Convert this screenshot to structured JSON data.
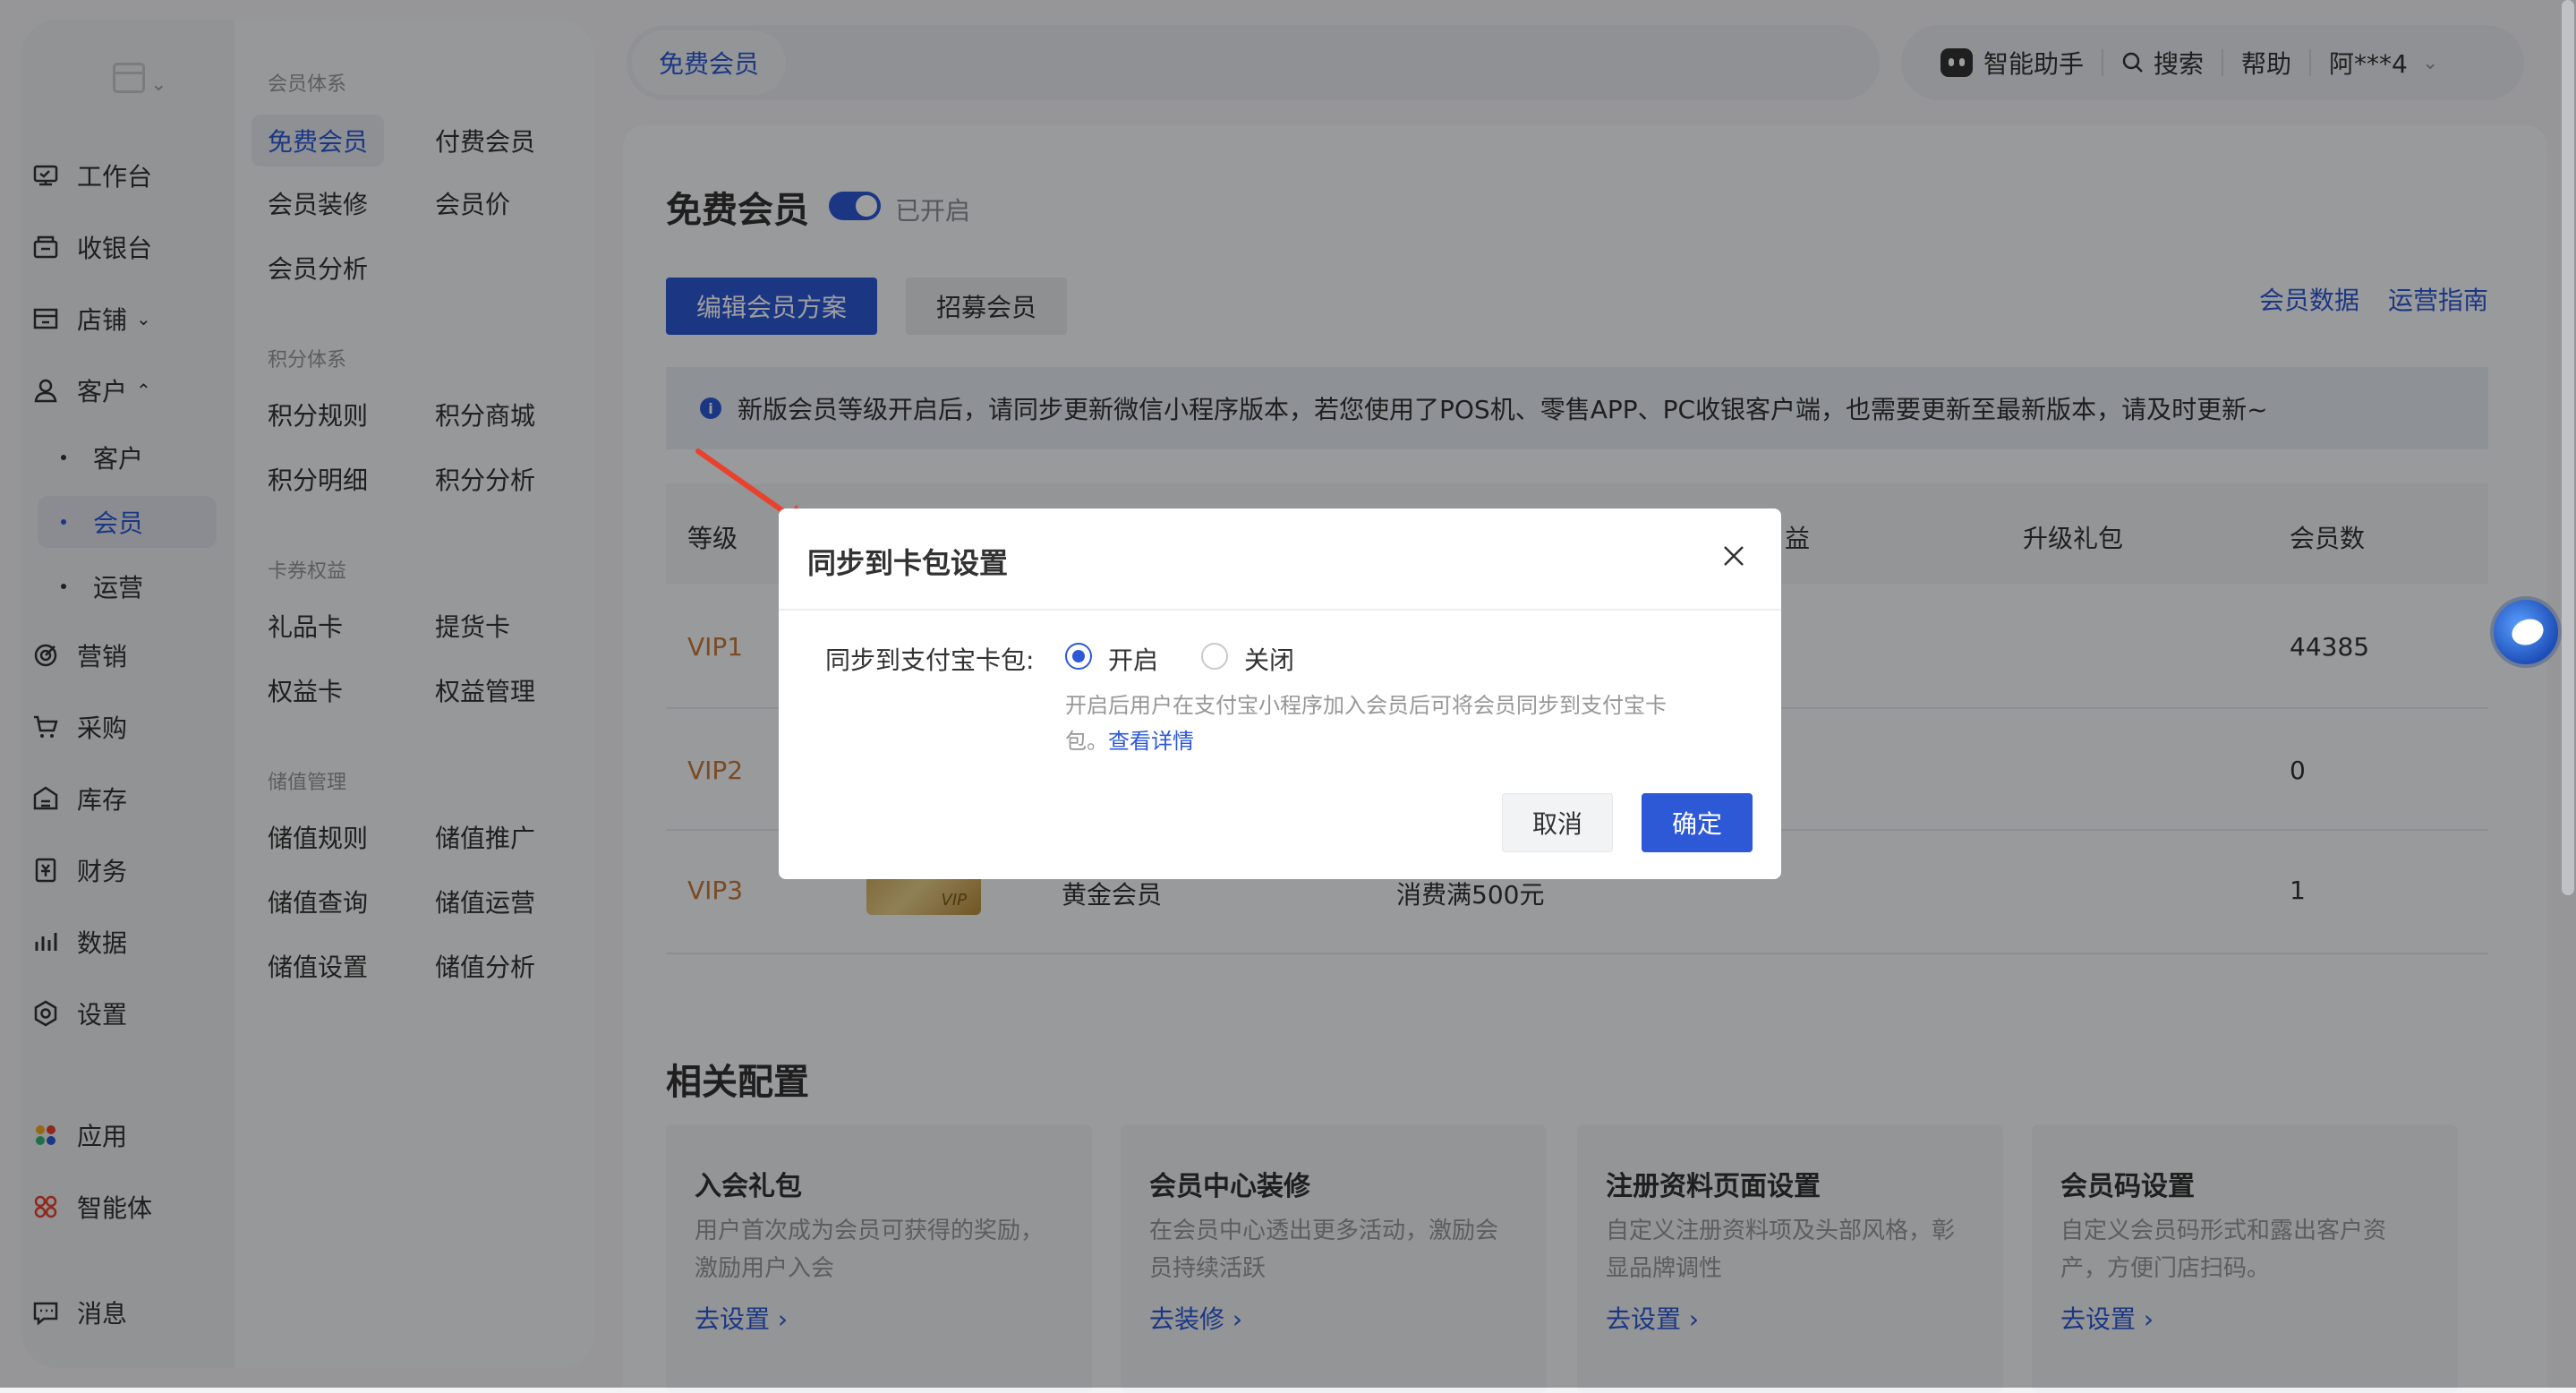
{
  "nav": {
    "items": [
      {
        "label": "工作台",
        "icon": "workbench-icon"
      },
      {
        "label": "收银台",
        "icon": "cashier-icon"
      },
      {
        "label": "店铺",
        "icon": "store-icon"
      },
      {
        "label": "客户",
        "icon": "user-icon"
      }
    ],
    "customer_sub": [
      "客户",
      "会员",
      "运营"
    ],
    "items_bottom": [
      {
        "label": "营销",
        "icon": "marketing-icon"
      },
      {
        "label": "采购",
        "icon": "cart-icon"
      },
      {
        "label": "库存",
        "icon": "inventory-icon"
      },
      {
        "label": "财务",
        "icon": "finance-icon"
      },
      {
        "label": "数据",
        "icon": "chart-icon"
      },
      {
        "label": "设置",
        "icon": "settings-icon"
      }
    ],
    "apps": "应用",
    "agent": "智能体",
    "messages": "消息"
  },
  "secondary": {
    "membership_title": "会员体系",
    "free_member": "免费会员",
    "paid_member": "付费会员",
    "member_decor": "会员装修",
    "member_price": "会员价",
    "member_analysis": "会员分析",
    "points_title": "积分体系",
    "points_rules": "积分规则",
    "points_mall": "积分商城",
    "points_detail": "积分明细",
    "points_analysis": "积分分析",
    "coupon_title": "卡券权益",
    "gift_card": "礼品卡",
    "pickup_card": "提货卡",
    "benefit_card": "权益卡",
    "benefit_mgmt": "权益管理",
    "stored_title": "储值管理",
    "stored_rules": "储值规则",
    "stored_promo": "储值推广",
    "stored_query": "储值查询",
    "stored_ops": "储值运营",
    "stored_settings": "储值设置",
    "stored_analysis": "储值分析"
  },
  "topbar": {
    "tab": "免费会员",
    "assistant": "智能助手",
    "search": "搜索",
    "help": "帮助",
    "user": "阿***4"
  },
  "main": {
    "title": "免费会员",
    "toggle_label": "已开启",
    "edit_plan": "编辑会员方案",
    "recruit": "招募会员",
    "member_data": "会员数据",
    "ops_guide": "运营指南",
    "notice": "新版会员等级开启后，请同步更新微信小程序版本，若您使用了POS机、零售APP、PC收银客户端，也需要更新至最新版本，请及时更新~",
    "table": {
      "headers": {
        "level": "等级",
        "benefits_partial": "益",
        "gift": "升级礼包",
        "count": "会员数"
      },
      "rows": [
        {
          "level": "VIP1",
          "name": "",
          "condition": "",
          "count": "44385"
        },
        {
          "level": "VIP2",
          "name": "",
          "condition": "",
          "count": "0"
        },
        {
          "level": "VIP3",
          "name": "黄金会员",
          "condition": "消费满500元",
          "count": "1",
          "card_text": "VIP"
        }
      ]
    },
    "related_title": "相关配置",
    "configs": [
      {
        "title": "入会礼包",
        "desc": "用户首次成为会员可获得的奖励，激励用户入会",
        "link": "去设置 ›"
      },
      {
        "title": "会员中心装修",
        "desc": "在会员中心透出更多活动，激励会员持续活跃",
        "link": "去装修 ›"
      },
      {
        "title": "注册资料页面设置",
        "desc": "自定义注册资料项及头部风格，彰显品牌调性",
        "link": "去设置 ›"
      },
      {
        "title": "会员码设置",
        "desc": "自定义会员码形式和露出客户资产，方便门店扫码。",
        "link": "去设置 ›"
      }
    ]
  },
  "modal": {
    "title": "同步到卡包设置",
    "label": "同步到支付宝卡包:",
    "on": "开启",
    "off": "关闭",
    "help": "开启后用户在支付宝小程序加入会员后可将会员同步到支付宝卡包。",
    "help_link": "查看详情",
    "cancel": "取消",
    "ok": "确定",
    "selected": "开启"
  },
  "colors": {
    "accent": "#2d59d6",
    "vip": "#c7793a",
    "arrow": "#e8422f"
  }
}
